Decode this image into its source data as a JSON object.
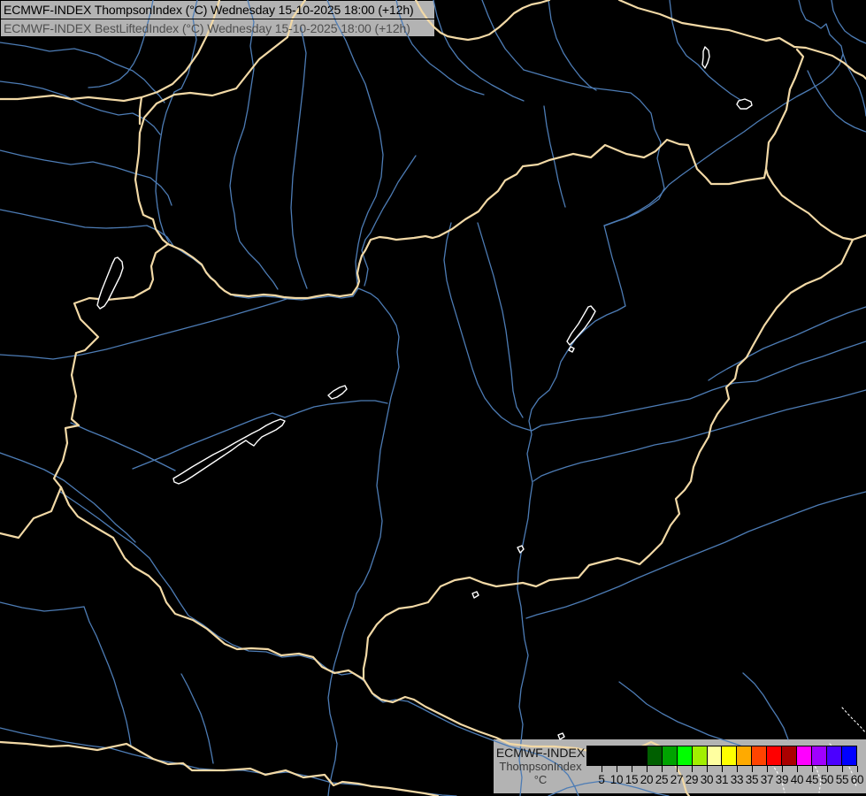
{
  "title": {
    "line1": "ECMWF-INDEX ThompsonIndex (°C) Wednesday 15-10-2025 18:00 (+12h)",
    "line2": "ECMWF-INDEX BestLiftedIndex (°C) Wednesday 15-10-2025 18:00 (+12h)"
  },
  "legend": {
    "product": "ECMWF-INDEX",
    "parameter": "ThompsonIndex",
    "unit": "°C",
    "tick_labels": [
      "5",
      "10",
      "15",
      "20",
      "25",
      "27",
      "29",
      "30",
      "31",
      "33",
      "35",
      "37",
      "39",
      "40",
      "45",
      "50",
      "55",
      "60"
    ],
    "cell_colors": [
      "#000000",
      "#000000",
      "#000000",
      "#000000",
      "#005f00",
      "#00a300",
      "#00ff00",
      "#a2f000",
      "#ffffa0",
      "#ffff00",
      "#ffaa00",
      "#ff4400",
      "#ff0000",
      "#aa0000",
      "#ff00ff",
      "#a000ff",
      "#4b00ff",
      "#0000ff"
    ]
  },
  "colors": {
    "background": "#000000",
    "border": "#f2d9a6",
    "river": "#4d7cb5",
    "lake": "#ffffff",
    "panel": "#b3b3b3",
    "title_line1": "#000000",
    "title_line2": "#4f4f4f"
  },
  "map": {
    "rivers": [
      "0,237 25,242 48,247 72,252 96,257 120,258 145,257 166,255 179,261 189,268 196,278",
      "196,278 208,286 219,293 229,301 235,310 244,319 250,326 257,331 266,335 281,337 298,335 313,336 326,338 341,339 356,337 373,335 386,337 399,335 405,326 419,332 427,338 434,347 441,356 448,368 451,381 449,398 451,415 447,431 442,449 438,469 434,489 430,509 428,529 426,549 429,569 432,589 430,607 424,626 418,644 411,659 403,671 399,686 393,701 388,716 383,734 378,751 374,769 371,789 373,807 377,823 381,841 379,859 375,876 372,891 371,900",
      "223,0 218,20 222,45 213,83 205,100 197,104 193,114 188,127 184,142 181,160 179,178 177,197 176,216 178,234 181,250 185,263 191,274",
      "173,0 170,15 166,30 162,45 157,60 151,72 144,82 135,90 124,95 112,98 100,99",
      "0,48 28,52 56,58 84,55 110,62 130,72 150,80 163,90 172,100 180,108 186,116",
      "0,92 24,95 48,100 73,108 94,118 114,125 134,130 150,128 164,135 174,143 181,152",
      "0,170 25,176 50,181 80,186 105,183 130,189 152,196 170,201 182,211 190,221 194,232",
      "280,0 287,25 283,52 287,78 283,104 280,124 276,144 270,161 265,178 262,194 260,210 262,227 265,242 267,259 271,273 281,286 293,298 301,309 309,319 314,327",
      "340,30 346,60 343,95 339,130 335,165 331,200 329,235 331,265 335,290 341,310 347,326",
      "370,0 380,25 391,46 401,70 413,95 421,121 429,148 433,175 431,200 425,222 416,240 409,258 405,276 402,296 403,311 404,321",
      "470,176 460,191 450,206 442,221 433,236 425,251 419,263 413,271 409,283 412,293 416,304 414,316 412,323",
      "448,0 452,18 458,35 466,50 476,62 486,72 497,80 507,88 517,95 527,100 537,104 547,107",
      "545,0 552,18 561,38 571,55 582,68 592,79",
      "592,79 616,86 641,93 666,99 691,102 713,105 723,113 736,128 740,146 747,161 743,179 748,199 751,213 745,225 734,233 722,240 709,246 695,251 684,255",
      "620,0 623,22 629,43 637,60 646,74 656,87 666,97 674,102",
      "757,0 760,25 766,48 776,63 789,73 801,86 813,96 826,106 837,113 848,120",
      "903,0 906,12 911,22 921,27 928,32 934,27 938,39 944,45 951,52 953,61 949,73 941,83 929,93 916,101 901,109 886,118 871,128 856,138 841,149 826,159 811,169 797,179 783,189 769,199 756,209 746,221 734,231 721,239 708,246 694,251 683,255",
      "683,255 687,271 692,291 698,311 703,329 707,346 698,351 686,356 673,363 661,373 651,383 642,396 634,409 629,426 621,441 609,451 601,463 598,476 601,491 596,513 599,531 602,546 599,566 597,586 593,606 589,626 586,646 585,666 589,686 591,706 593,723 597,741 593,761 589,779 587,799 591,819 589,839 587,859 590,879 588,900",
      "953,61 958,75 964,86 971,99 975,111 978,123 979,131",
      "940,0 942,12 948,25 955,35 963,41 972,46 979,49",
      "913,80 920,95 928,108 936,120 945,130 955,138 966,144 976,148 979,149",
      "510,252 505,272 502,294 505,317 510,337 516,357 522,377 528,397 534,417 540,434 548,450 557,462 567,472 579,480 591,484 601,487",
      "540,252 546,272 552,292 558,312 563,332 568,352 572,374 575,397 578,420 580,442 584,460 591,472",
      "615,120 618,142 622,163 627,184 631,204 635,220 639,234",
      "979,347 958,354 938,362 920,370 900,379 880,387 863,394 848,402 835,410 822,417 810,424 801,430",
      "979,386 955,394 930,403 905,411 880,421 855,431 830,433 805,441 780,451 755,456 730,461 705,466 680,471 655,474 632,478 612,481 601,487",
      "979,441 950,449 920,456 890,463 862,471 835,479 810,486 785,493 762,499 740,503 718,509 697,514 676,519 657,523 640,528 625,533 612,538 603,544",
      "979,556 952,563 925,571 898,581 872,591 846,601 820,613 795,623 770,633 746,643 722,653 700,663 680,671 660,679 640,686 622,691 607,695 595,699",
      "0,401 30,403 60,406 92,401 120,395 150,387 180,379 210,371 240,363 268,355 295,347 315,341 327,337",
      "80,478 100,487 120,495 140,504 158,512 174,520 188,527 198,532",
      "150,530 170,522 190,514 210,505 230,497 250,489 270,481 290,473 308,467 322,472 338,466 355,460 372,457 390,455 408,453 424,453 438,456",
      "0,512 25,521 50,531 72,543 90,557 106,569 119,581 131,593 143,603 153,613",
      "68,556 90,571 111,586 131,601 151,615 169,631 181,649 193,665 203,681 213,696 229,706 246,719 263,729 281,736 301,737 319,743 339,741 357,746 371,757 386,763 399,761 413,771 423,787 433,794 447,791 461,793 477,801 496,811 516,821 536,829 557,837 576,844 596,849 614,855 630,864 642,876 650,890 654,900",
      "0,823 25,829 50,834 75,839 100,843 125,846 150,853 175,859 200,863 225,869 250,871 275,871 300,875 325,873 350,878 375,885 400,887 425,889 450,893 475,896 500,899 516,900",
      "95,686 101,703 109,719 116,736 123,753 129,769 134,786 139,801 143,816 146,831 148,843",
      "0,681 25,687 50,691 72,689 95,686",
      "205,762 213,777 220,792 227,807 232,822 236,837 239,852 241,863",
      "700,771 716,783 731,796 749,807 766,816 783,823 801,831 819,837 837,843",
      "840,761 853,773 863,786 871,799 879,811 886,823 891,836",
      "620,900 641,891 661,886 681,883 701,886 721,891 741,897 756,900",
      "490,0 494,18 500,36 508,52 518,66 530,78 543,88 556,96 569,103 580,109 592,114"
    ],
    "borders": [
      "345,0 331,20 325,42 293,67 267,100 240,108 215,105 197,107 177,117 163,133 158,150 157,173 153,203 157,227 162,243 173,248 176,259 184,271 190,276",
      "248,0 242,20 234,40 224,60 210,80 195,95 178,104 160,110 140,114 120,112 100,110 80,112 60,108 40,110 20,112 0,112",
      "160,110 158,125 158,140",
      "190,276 176,286 171,301 173,316 169,326 151,336 121,339 101,337 84,343 91,361 111,381 96,396 86,399 81,424 86,448 81,474 89,481 74,484 76,501 71,521 61,541 69,551",
      "0,603 21,608 38,586 58,578 69,551",
      "69,551 78,571 88,584 104,594 128,608 141,631 151,641 168,651 181,664 188,681 198,694 218,701 234,711 254,728 268,734 284,733 303,734 318,741 338,739 354,743 364,754 378,761 394,758 411,768 421,784 431,791 444,794 458,788 468,791 481,799 501,809 521,819 541,827 561,834 576,841 601,844 626,844 651,846 676,851 701,854 721,846 736,839 751,846 761,861 771,879 776,896 779,900",
      "190,276 206,283 218,291 228,299 233,308 238,314 243,318 248,324 254,329 261,333 271,334 281,335 298,333 311,334 321,336 334,337 348,337 358,335 371,333 384,335 398,333 404,324 406,318 404,309 406,299 409,289 413,283 419,271 429,268 438,269 448,271 458,270 468,269 481,267 489,269 496,267 511,259 526,248 541,239 551,226 563,216 571,204 584,197 591,188 608,186 621,181 648,174 668,178 684,164 708,174 728,178 741,171 754,158 768,163 778,164 788,191 798,201 804,208 824,208 844,204 864,201 866,191",
      "901,56 908,64 899,88 893,101 889,124 876,151 869,161 866,191",
      "866,191 868,198 874,208 884,221 898,231 914,241 928,254 941,263 953,269 964,271 979,266",
      "964,271 951,298 928,314 911,321 894,331 878,348 864,368 851,391 844,404 834,414 831,428 821,438 824,451 811,468 804,481 801,494 791,511 784,528 781,544 774,554 764,564 768,581 758,594 748,614 734,628 723,638 711,634 698,631",
      "698,631 681,635 666,639 654,653 638,654 621,656 606,663 591,659 576,661 561,663 546,659 531,653 514,656 498,663 484,681 466,686 451,688 436,696 426,706 416,721 414,741 411,756 411,768",
      "700,0 721,9 746,16 771,26 801,31 824,34 848,41 866,46 881,43 898,53 911,54 928,59 941,63 954,71 966,81 976,86 979,89",
      "470,0 477,13 484,23 491,31 498,37 506,41 516,43 529,45 541,43 553,39 564,31 573,23 581,15 591,9 601,5 611,3 621,0",
      "0,839 30,841 57,844 77,843 110,848 143,841 173,858 190,864 207,863 217,871 253,871 283,869 300,876 323,871 343,879 367,876 377,888 387,884 405,886 420,889 440,891 460,894 480,897 495,900"
    ],
    "lakes": [
      "133,291 138,296 139,303 136,312 131,322 126,332 122,340 118,346 113,349 110,345 112,337 115,328 119,318 123,308 127,298 130,292",
      "196,541 206,535 217,528 229,521 241,514 253,508 265,501 276,495 285,490 293,486 301,481 309,477 317,474 322,476 319,481 312,486 304,490 296,494 291,499 287,504 282,501 278,498 270,503 262,509 253,515 244,521 235,527 226,533 217,539 209,544 202,547 197,545",
      "371,447 377,442 384,438 390,436 392,440 387,445 381,449 375,451",
      "668,346 673,352 668,361 661,371 654,379 648,386 644,390 641,386 646,377 654,366 661,354 665,347",
      "645,392 649,394 647,398 643,396",
      "835,114 842,112 849,115 850,119 844,123 837,123 833,118",
      "797,53 801,57 802,64 800,71 797,77 794,73 795,65 795,58",
      "585,619 590,617 592,621 588,625",
      "534,671 539,669 541,673 536,676",
      "631,831 636,829 638,833 633,836"
    ],
    "dotted": [
      "900,846 913,856 923,869 928,883 926,896",
      "938,841 950,851 958,863 964,876 968,889",
      "952,800 963,812 973,822 979,829",
      "870,860 878,872 884,884 887,896"
    ]
  }
}
